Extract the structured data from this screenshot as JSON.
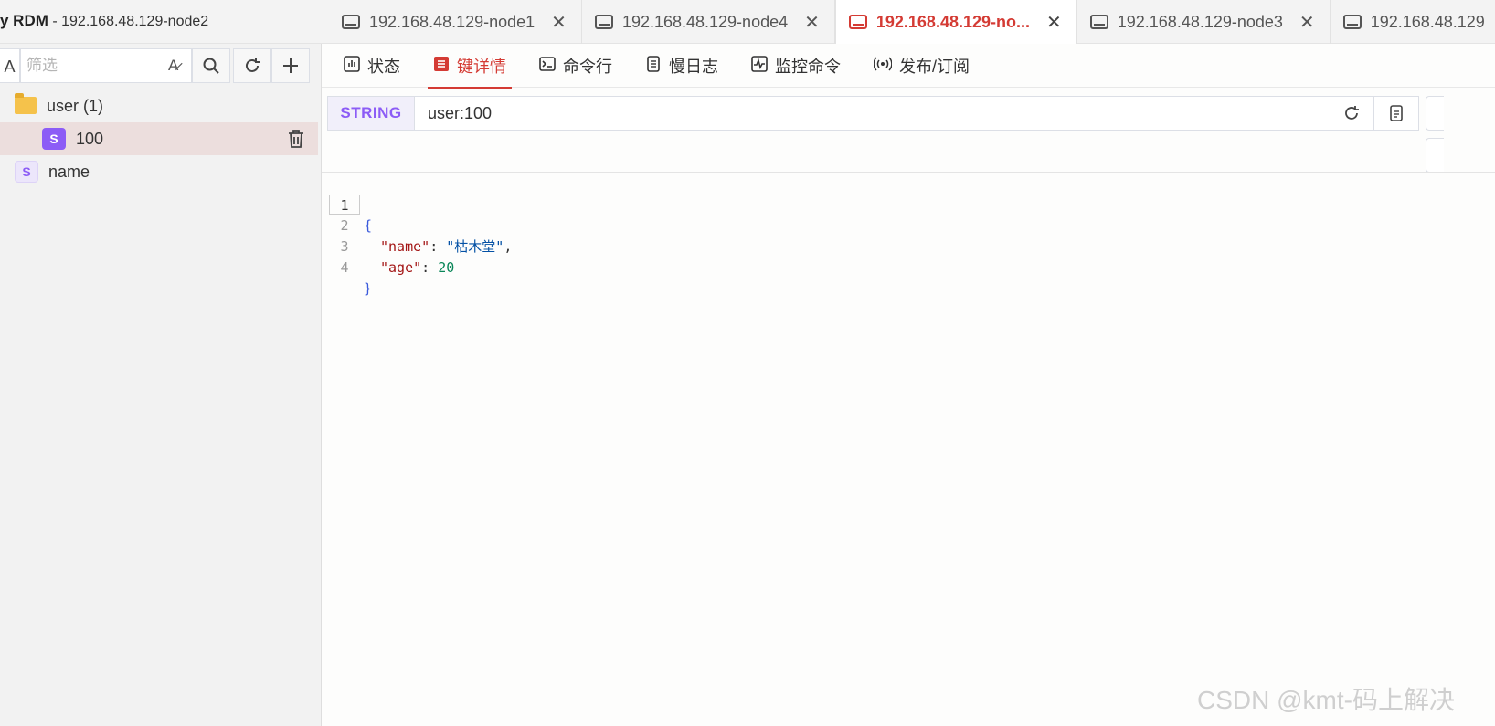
{
  "window": {
    "app_name": "y RDM",
    "connection_suffix": " - 192.168.48.129-node2"
  },
  "tabs": [
    {
      "label": "192.168.48.129-node1",
      "active": false
    },
    {
      "label": "192.168.48.129-node4",
      "active": false
    },
    {
      "label": "192.168.48.129-no...",
      "active": true
    },
    {
      "label": "192.168.48.129-node3",
      "active": false
    },
    {
      "label": "192.168.48.129",
      "active": false
    }
  ],
  "sidebar": {
    "case_label": "A",
    "filter_placeholder": "筛选",
    "filter_value": "",
    "tree": [
      {
        "label": "user (1)",
        "kind": "folder"
      },
      {
        "label": "100",
        "badge": "S",
        "selected": true
      },
      {
        "label": "name",
        "badge": "S",
        "selected": false
      }
    ]
  },
  "subtabs": [
    {
      "label": "状态",
      "icon": "chart-icon"
    },
    {
      "label": "键详情",
      "icon": "key-detail-icon",
      "active": true
    },
    {
      "label": "命令行",
      "icon": "terminal-icon"
    },
    {
      "label": "慢日志",
      "icon": "log-icon"
    },
    {
      "label": "监控命令",
      "icon": "monitor-icon"
    },
    {
      "label": "发布/订阅",
      "icon": "broadcast-icon"
    }
  ],
  "key_detail": {
    "type": "STRING",
    "key_name": "user:100"
  },
  "editor": {
    "lines": [
      {
        "num": "1"
      },
      {
        "num": "2",
        "key": "\"name\"",
        "value": "\"枯木堂\""
      },
      {
        "num": "3",
        "key": "\"age\"",
        "value": "20"
      },
      {
        "num": "4"
      }
    ],
    "open_brace": "{",
    "close_brace": "}"
  },
  "watermark": "CSDN @kmt-码上解决",
  "colors": {
    "accent": "#d43b34",
    "string_badge": "#8c5cf6"
  }
}
